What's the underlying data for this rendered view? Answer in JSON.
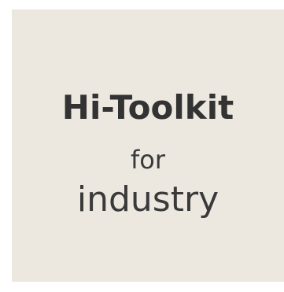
{
  "logo": {
    "title": "Hi-Toolkit",
    "line_for": "for",
    "line_industry": "industry",
    "background_color": "#ece8e0",
    "text_color": "#333333"
  }
}
